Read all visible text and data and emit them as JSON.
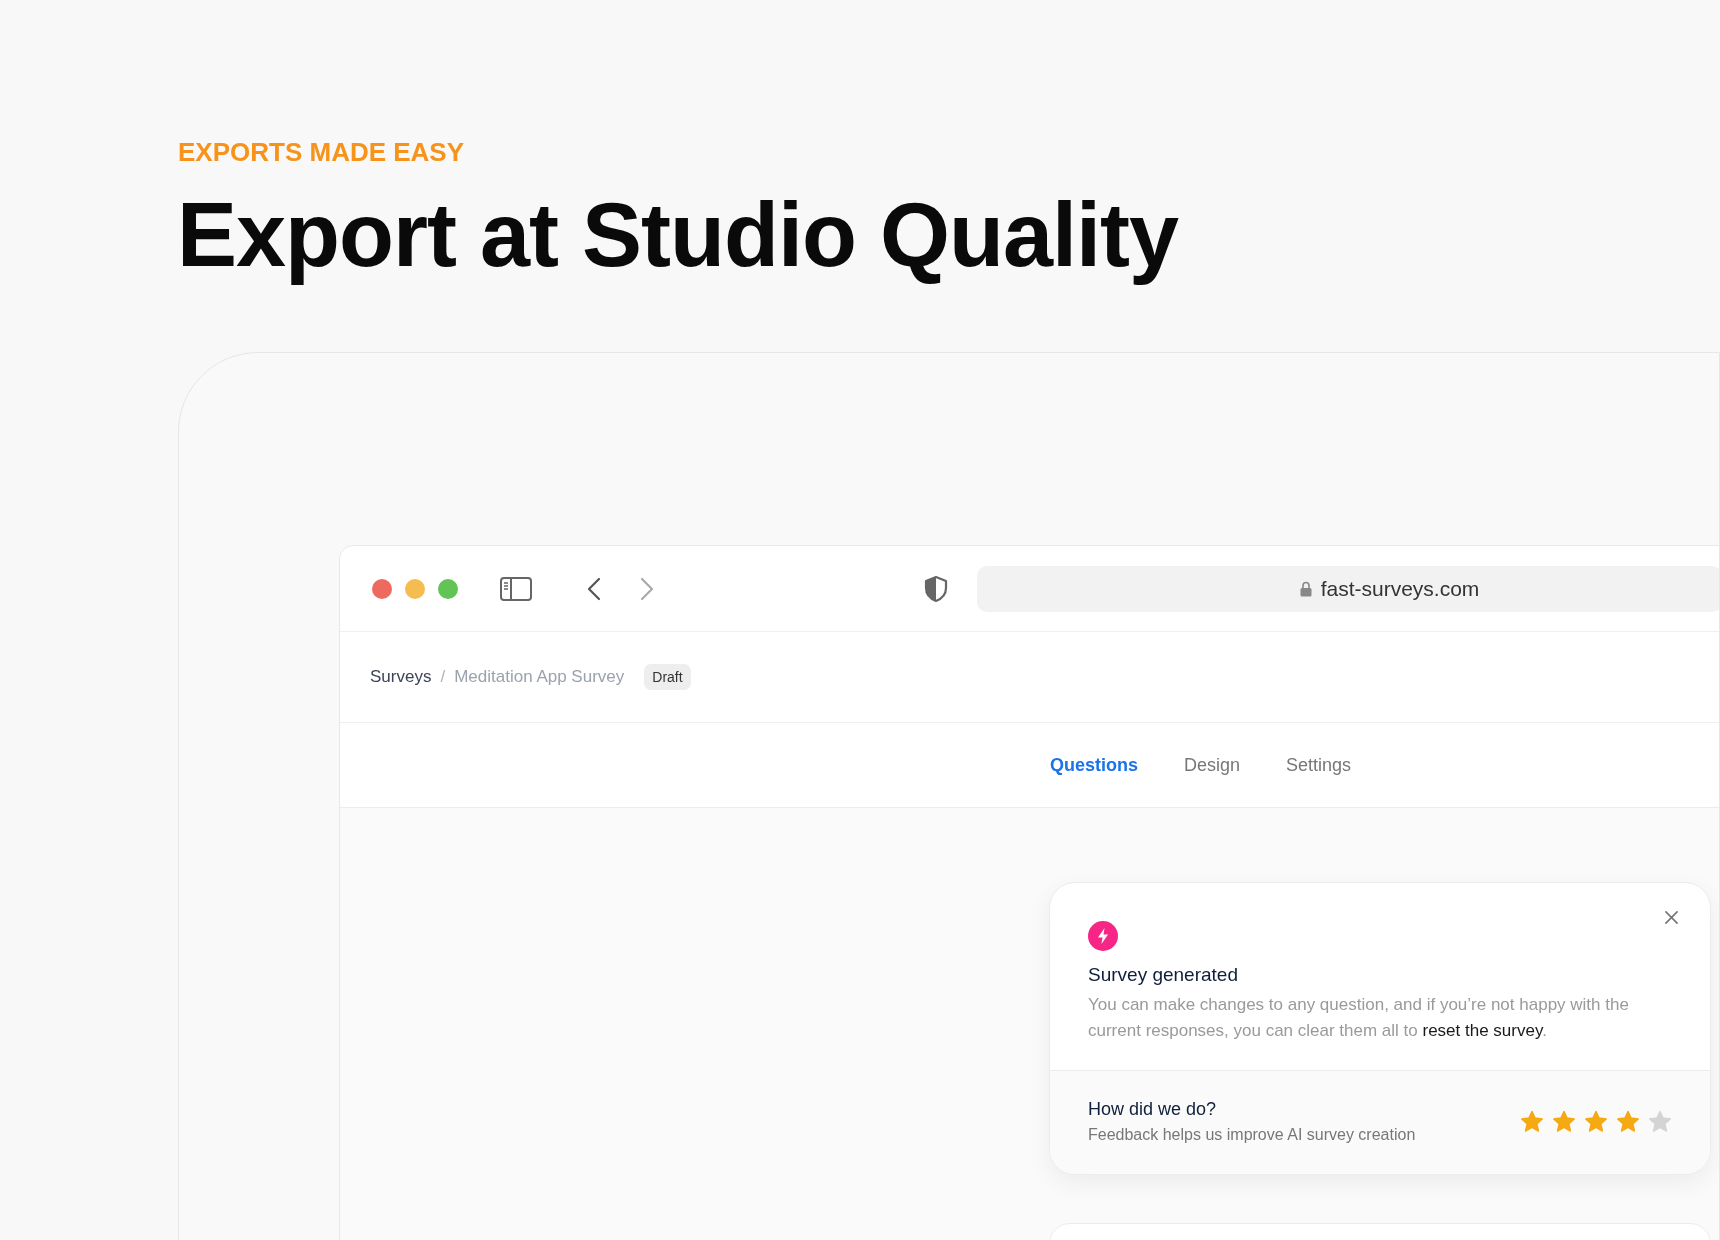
{
  "eyebrow": "EXPORTS MADE EASY",
  "headline": "Export at Studio Quality",
  "browser": {
    "back_disabled": false,
    "forward_disabled": true,
    "url": "fast-surveys.com"
  },
  "breadcrumb": [
    {
      "label": "Surveys",
      "current": false
    },
    {
      "label": "Meditation App Survey",
      "current": true
    }
  ],
  "breadcrumb_separator": "/",
  "status_badge": "Draft",
  "tabs": [
    {
      "label": "Questions",
      "selected": true
    },
    {
      "label": "Design",
      "selected": false
    },
    {
      "label": "Settings",
      "selected": false
    }
  ],
  "notice": {
    "title": "Survey generated",
    "text": "You can make changes to any question, and if you’re not happy with the current responses, you can clear them all to",
    "link": "reset the survey",
    "after": "."
  },
  "feedback": {
    "title": "How did we do?",
    "subtitle": "Feedback helps us improve AI survey creation",
    "stars": 4
  }
}
